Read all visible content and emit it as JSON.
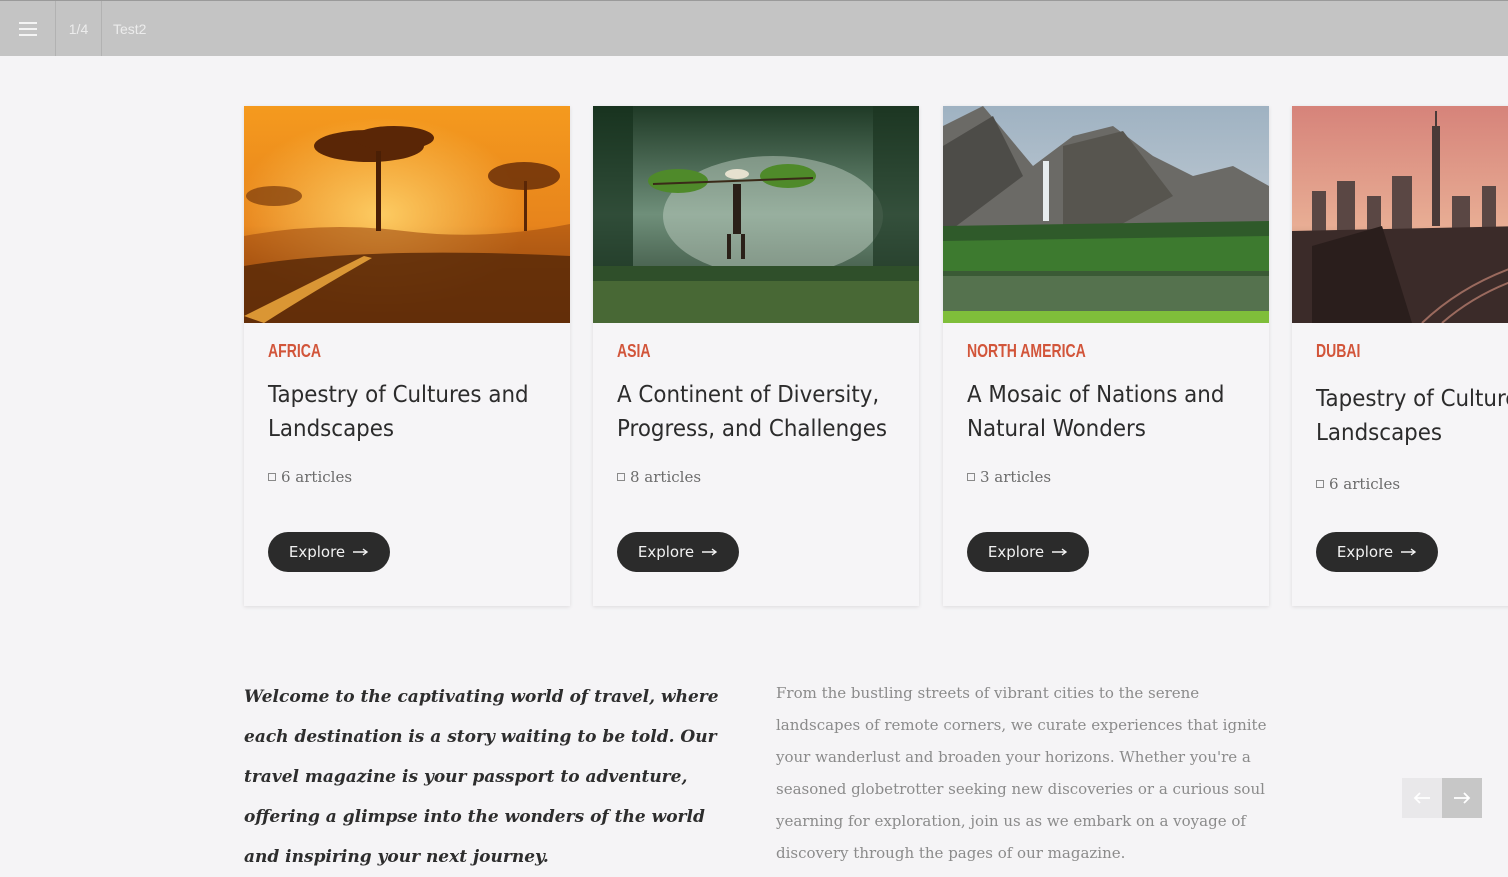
{
  "topbar": {
    "menu_icon": "hamburger-menu-icon",
    "page_indicator": "1/4",
    "doc_title": "Test2"
  },
  "cards": [
    {
      "region": "AFRICA",
      "title": "Tapestry of Cultures and Landscapes",
      "count": "6 articles",
      "button": "Explore",
      "image": "savanna-sunset-acacia"
    },
    {
      "region": "ASIA",
      "title": "A Continent of Diversity, Progress, and Challenges",
      "count": "8 articles",
      "button": "Explore",
      "image": "rice-farmer-forest"
    },
    {
      "region": "NORTH AMERICA",
      "title": "A Mosaic of Nations and Natural Wonders",
      "count": "3 articles",
      "button": "Explore",
      "image": "mountain-waterfall-lake"
    },
    {
      "region": "DUBAI",
      "title": "Tapestry of Cultures and Landscapes",
      "count": "6 articles",
      "button": "Explore",
      "image": "city-skyline-dusk"
    }
  ],
  "intro_text": "Welcome to the captivating world of travel, where each destination is a story waiting to be told. Our travel magazine is your passport to adventure, offering a glimpse into the wonders of the world and inspiring your next journey.",
  "description_text": "From the bustling streets of vibrant cities to the serene landscapes of remote corners, we curate experiences that ignite your wanderlust and broaden your horizons. Whether you're a seasoned globetrotter seeking new discoveries or a curious soul yearning for exploration, join us as we embark on a voyage of discovery through the pages of our magazine.",
  "slider_nav": {
    "prev_icon": "arrow-left-icon",
    "next_icon": "arrow-right-icon"
  },
  "colors": {
    "accent": "#d2553a",
    "button_bg": "#2b2b2b",
    "topbar_bg": "#c4c4c4",
    "page_bg": "#f5f4f6"
  }
}
